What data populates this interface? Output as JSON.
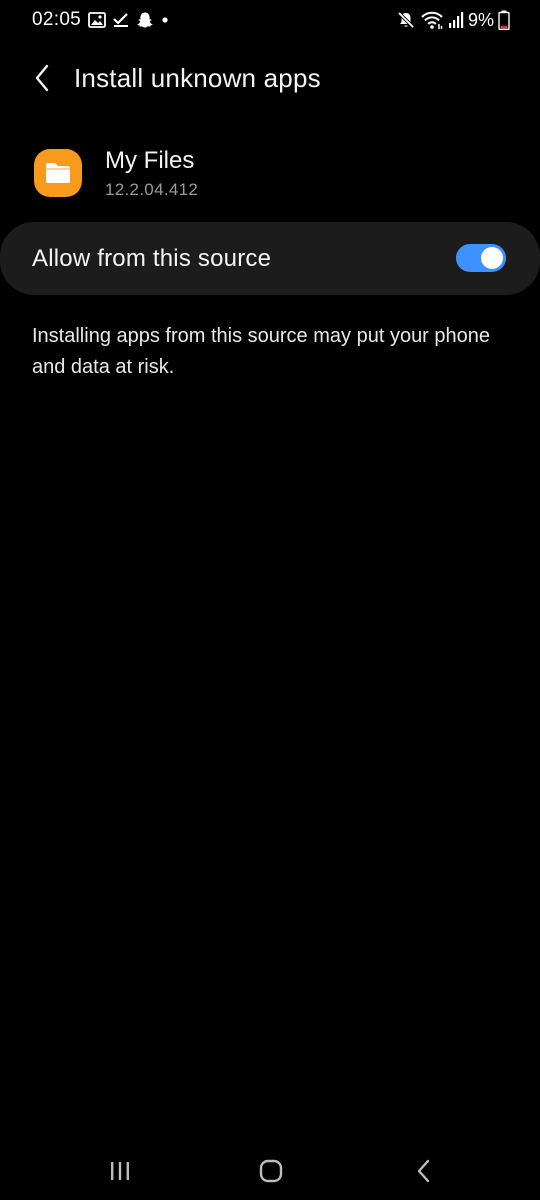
{
  "status_bar": {
    "time": "02:05",
    "left_icons": [
      "gallery-icon",
      "task-check-icon",
      "snapchat-icon",
      "dot-icon"
    ],
    "right_icons": [
      "mute-icon",
      "wifi-icon",
      "signal-icon",
      "battery-icon"
    ],
    "battery_percent": "9%"
  },
  "header": {
    "title": "Install unknown apps",
    "back_icon": "chevron-left-icon"
  },
  "app": {
    "name": "My Files",
    "version": "12.2.04.412",
    "icon": "folder-icon",
    "icon_color": "#f89a1c"
  },
  "setting": {
    "label": "Allow from this source",
    "enabled": true,
    "accent_color": "#3e91ff"
  },
  "warning": {
    "text": "Installing apps from this source may put your phone and data at risk."
  },
  "nav_bar": {
    "buttons": [
      "recents-icon",
      "home-icon",
      "back-icon"
    ]
  }
}
